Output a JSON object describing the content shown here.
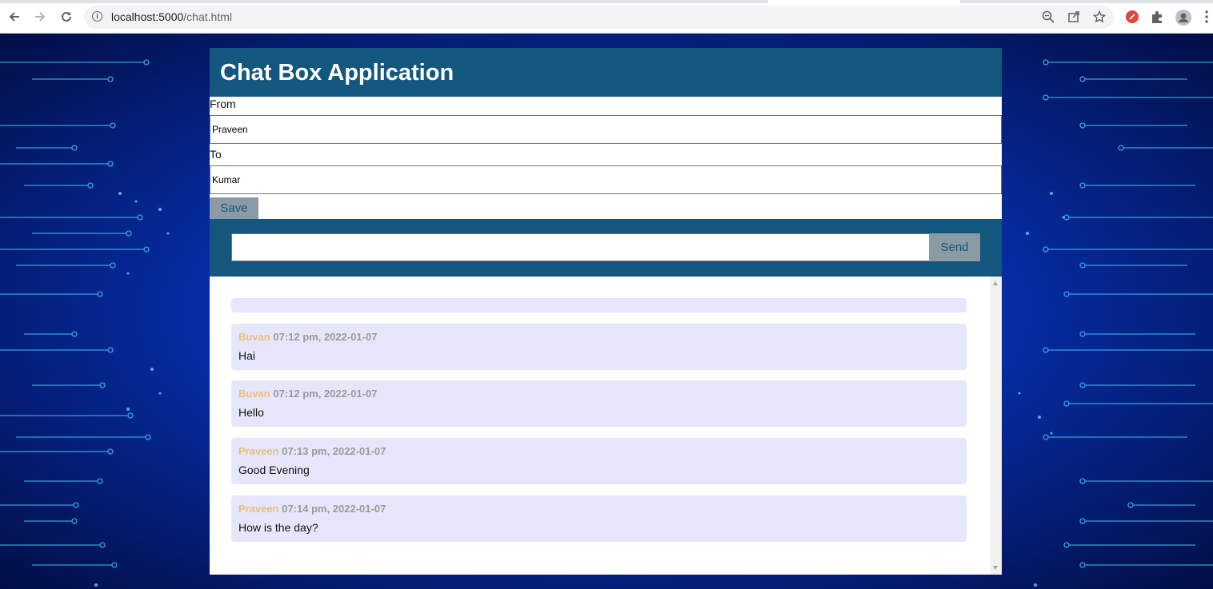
{
  "browser": {
    "url_host": "localhost:5000",
    "url_path": "/chat.html"
  },
  "app": {
    "title": "Chat Box Application",
    "from_label": "From",
    "from_value": "Praveen",
    "to_label": "To",
    "to_value": "Kumar",
    "save_label": "Save",
    "message_value": "",
    "send_label": "Send"
  },
  "messages": [
    {
      "sender": "Buvan",
      "time": "07:12 pm, 2022-01-07",
      "text": "Hai"
    },
    {
      "sender": "Buvan",
      "time": "07:12 pm, 2022-01-07",
      "text": "Hello"
    },
    {
      "sender": "Praveen",
      "time": "07:13 pm, 2022-01-07",
      "text": "Good Evening"
    },
    {
      "sender": "Praveen",
      "time": "07:14 pm, 2022-01-07",
      "text": "How is the day?"
    }
  ],
  "colors": {
    "header": "#13577e",
    "bubble": "#e6e6fa",
    "sender": "#e8bf7e",
    "button": "#8a9ba5"
  }
}
